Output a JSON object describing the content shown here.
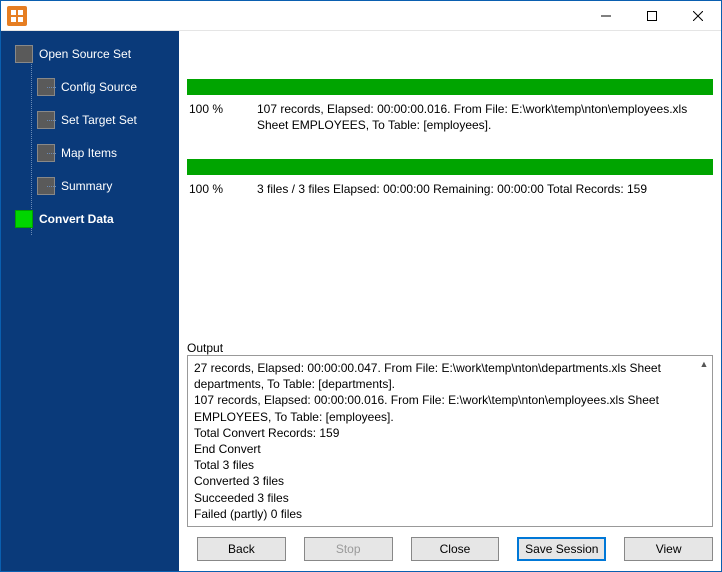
{
  "sidebar": {
    "root": "Open Source Set",
    "items": [
      "Config Source",
      "Set Target Set",
      "Map Items",
      "Summary",
      "Convert Data"
    ],
    "activeIndex": 4
  },
  "progress1": {
    "percent": "100 %",
    "info": "107 records,    Elapsed: 00:00:00.016.    From File: E:\\work\\temp\\nton\\employees.xls Sheet EMPLOYEES,    To Table: [employees]."
  },
  "progress2": {
    "percent": "100 %",
    "info": "3 files / 3 files    Elapsed: 00:00:00    Remaining: 00:00:00    Total Records: 159"
  },
  "outputLabel": "Output",
  "outputLines": [
    "27 records,    Elapsed: 00:00:00.047.    From File: E:\\work\\temp\\nton\\departments.xls Sheet departments,    To Table: [departments].",
    "107 records,    Elapsed: 00:00:00.016.    From File: E:\\work\\temp\\nton\\employees.xls Sheet EMPLOYEES,    To Table: [employees].",
    "Total Convert Records: 159",
    "End Convert",
    "Total 3 files",
    "Converted 3 files",
    "Succeeded 3 files",
    "Failed (partly) 0 files"
  ],
  "buttons": {
    "back": "Back",
    "stop": "Stop",
    "close": "Close",
    "save": "Save Session",
    "view": "View"
  },
  "colors": {
    "sidebar": "#0a3a7a",
    "progress": "#00a400",
    "activeStep": "#00d500",
    "windowBorder": "#0a5fb0",
    "primaryBorder": "#0078d7"
  }
}
